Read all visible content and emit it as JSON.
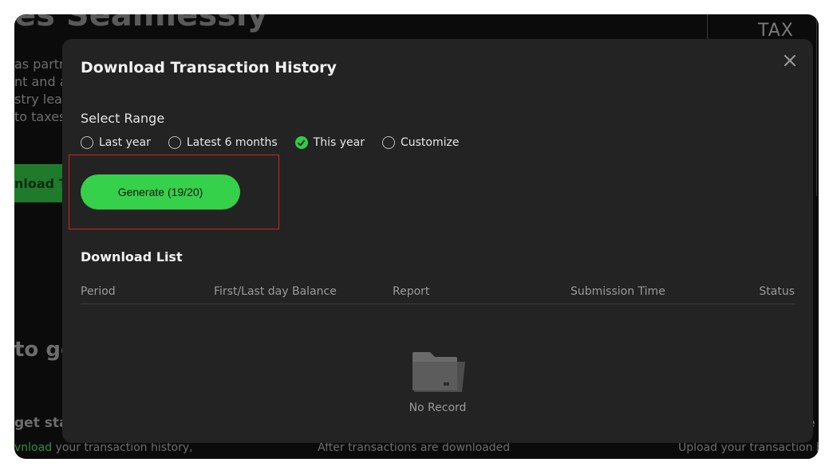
{
  "background": {
    "hero_title": "es Seamlessly",
    "paragraph_lines": [
      "as partn",
      "nt and ac",
      "stry lead",
      "to taxes"
    ],
    "green_button_label": "nload Tr",
    "heading2": "to get",
    "get_started": "get star",
    "right_tax_label": "TAX",
    "right_e": "e",
    "bottom_left_accent": "vnload",
    "bottom_left_rest": " your transaction history,",
    "bottom_middle": "After transactions are downloaded",
    "bottom_right": "Upload your transaction hist"
  },
  "modal": {
    "title": "Download Transaction History",
    "close_icon": "close-icon",
    "select_range_label": "Select Range",
    "range_options": [
      {
        "label": "Last year",
        "checked": false
      },
      {
        "label": "Latest 6 months",
        "checked": false
      },
      {
        "label": "This year",
        "checked": true
      },
      {
        "label": "Customize",
        "checked": false
      }
    ],
    "generate_button": "Generate (19/20)",
    "download_list_title": "Download List",
    "table_columns": [
      "Period",
      "First/Last day Balance",
      "Report",
      "Submission Time",
      "Status"
    ],
    "empty_icon": "folder-icon",
    "empty_text": "No Record"
  },
  "colors": {
    "accent_green": "#35d14a",
    "modal_bg": "#232323",
    "highlight_red": "#d32626"
  }
}
